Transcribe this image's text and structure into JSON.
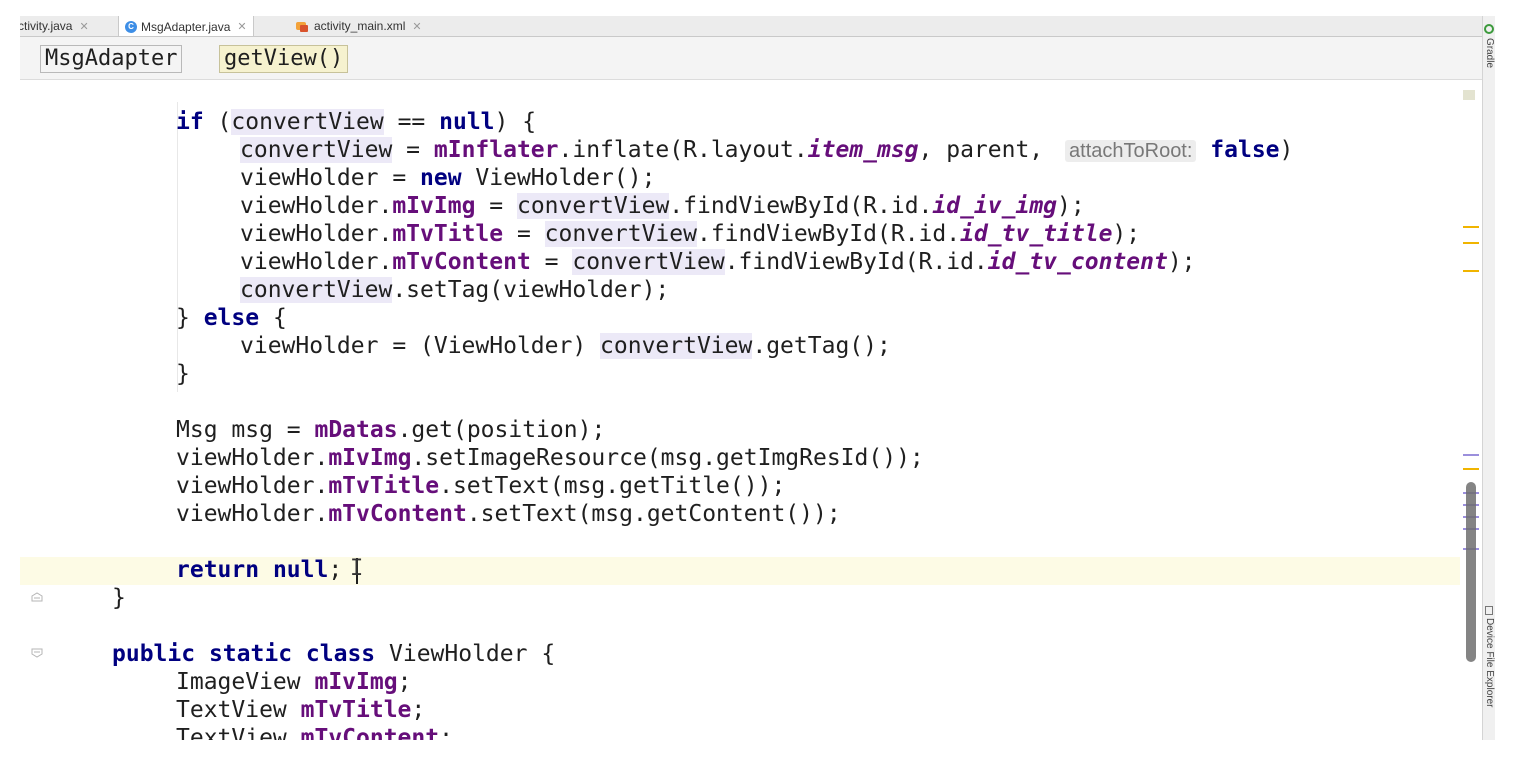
{
  "tabs": [
    {
      "label": "ctivity.java",
      "icon": "java-file-icon"
    },
    {
      "label": "MsgAdapter.java",
      "icon": "class-icon"
    },
    {
      "label": "activity_main.xml",
      "icon": "xml-layout-icon"
    }
  ],
  "breadcrumb": {
    "class": "MsgAdapter",
    "method": "getView()"
  },
  "code_lines": [
    {
      "indent": 2,
      "segments": [
        {
          "t": "if",
          "s": "kw"
        },
        {
          "t": " ("
        },
        {
          "t": "convertView",
          "s": "hl"
        },
        {
          "t": " == "
        },
        {
          "t": "null",
          "s": "kw"
        },
        {
          "t": ") {"
        }
      ]
    },
    {
      "indent": 3,
      "segments": [
        {
          "t": "convertView",
          "s": "hl"
        },
        {
          "t": " = "
        },
        {
          "t": "mInflater",
          "s": "fld"
        },
        {
          "t": ".inflate(R.layout."
        },
        {
          "t": "item_msg",
          "s": "sf"
        },
        {
          "t": ", parent, "
        },
        {
          "t": "attachToRoot:",
          "s": "hint"
        },
        {
          "t": " "
        },
        {
          "t": "false",
          "s": "kw"
        },
        {
          "t": ")"
        }
      ]
    },
    {
      "indent": 3,
      "segments": [
        {
          "t": "viewHolder = "
        },
        {
          "t": "new",
          "s": "kw"
        },
        {
          "t": " ViewHolder();"
        }
      ]
    },
    {
      "indent": 3,
      "segments": [
        {
          "t": "viewHolder."
        },
        {
          "t": "mIvImg",
          "s": "fld"
        },
        {
          "t": " = "
        },
        {
          "t": "convertView",
          "s": "hl"
        },
        {
          "t": ".findViewById(R.id."
        },
        {
          "t": "id_iv_img",
          "s": "sf"
        },
        {
          "t": ");"
        }
      ]
    },
    {
      "indent": 3,
      "segments": [
        {
          "t": "viewHolder."
        },
        {
          "t": "mTvTitle",
          "s": "fld"
        },
        {
          "t": " = "
        },
        {
          "t": "convertView",
          "s": "hl"
        },
        {
          "t": ".findViewById(R.id."
        },
        {
          "t": "id_tv_title",
          "s": "sf"
        },
        {
          "t": ");"
        }
      ]
    },
    {
      "indent": 3,
      "segments": [
        {
          "t": "viewHolder."
        },
        {
          "t": "mTvContent",
          "s": "fld"
        },
        {
          "t": " = "
        },
        {
          "t": "convertView",
          "s": "hl"
        },
        {
          "t": ".findViewById(R.id."
        },
        {
          "t": "id_tv_content",
          "s": "sf"
        },
        {
          "t": ");"
        }
      ]
    },
    {
      "indent": 3,
      "segments": [
        {
          "t": "convertView",
          "s": "hl"
        },
        {
          "t": ".setTag(viewHolder);"
        }
      ]
    },
    {
      "indent": 2,
      "segments": [
        {
          "t": "} "
        },
        {
          "t": "else",
          "s": "kw"
        },
        {
          "t": " {"
        }
      ]
    },
    {
      "indent": 3,
      "segments": [
        {
          "t": "viewHolder = (ViewHolder) "
        },
        {
          "t": "convertView",
          "s": "hl"
        },
        {
          "t": ".getTag();"
        }
      ]
    },
    {
      "indent": 2,
      "segments": [
        {
          "t": "}"
        }
      ]
    },
    {
      "indent": 0,
      "segments": []
    },
    {
      "indent": 2,
      "segments": [
        {
          "t": "Msg msg = "
        },
        {
          "t": "mDatas",
          "s": "fld"
        },
        {
          "t": ".get(position);"
        }
      ]
    },
    {
      "indent": 2,
      "segments": [
        {
          "t": "viewHolder."
        },
        {
          "t": "mIvImg",
          "s": "fld"
        },
        {
          "t": ".setImageResource(msg.getImgResId());"
        }
      ]
    },
    {
      "indent": 2,
      "segments": [
        {
          "t": "viewHolder."
        },
        {
          "t": "mTvTitle",
          "s": "fld"
        },
        {
          "t": ".setText(msg.getTitle());"
        }
      ]
    },
    {
      "indent": 2,
      "segments": [
        {
          "t": "viewHolder."
        },
        {
          "t": "mTvContent",
          "s": "fld"
        },
        {
          "t": ".setText(msg.getContent());"
        }
      ]
    },
    {
      "indent": 0,
      "segments": []
    },
    {
      "indent": 2,
      "segments": [
        {
          "t": "return",
          "s": "kw"
        },
        {
          "t": " "
        },
        {
          "t": "null",
          "s": "kw"
        },
        {
          "t": ";"
        }
      ]
    },
    {
      "indent": 1,
      "segments": [
        {
          "t": "}"
        }
      ]
    },
    {
      "indent": 0,
      "segments": []
    },
    {
      "indent": 1,
      "segments": [
        {
          "t": "public",
          "s": "kw"
        },
        {
          "t": " "
        },
        {
          "t": "static",
          "s": "kw"
        },
        {
          "t": " "
        },
        {
          "t": "class",
          "s": "kw"
        },
        {
          "t": " ViewHolder {"
        }
      ]
    },
    {
      "indent": 2,
      "segments": [
        {
          "t": "ImageView "
        },
        {
          "t": "mIvImg",
          "s": "fld"
        },
        {
          "t": ";"
        }
      ]
    },
    {
      "indent": 2,
      "segments": [
        {
          "t": "TextView "
        },
        {
          "t": "mTvTitle",
          "s": "fld"
        },
        {
          "t": ";"
        }
      ]
    },
    {
      "indent": 2,
      "segments": [
        {
          "t": "TextView "
        },
        {
          "t": "mTvContent",
          "s": "fld"
        },
        {
          "t": ";"
        }
      ]
    }
  ],
  "side_tools": {
    "gradle": "Gradle",
    "device_explorer": "Device File Explorer"
  },
  "colors": {
    "keyword": "#000080",
    "field": "#660e7a",
    "highlight": "#ece9f7",
    "caret_line": "#fdfbe5",
    "warning_mark": "#f0b400",
    "info_mark": "#9b8fdc"
  }
}
